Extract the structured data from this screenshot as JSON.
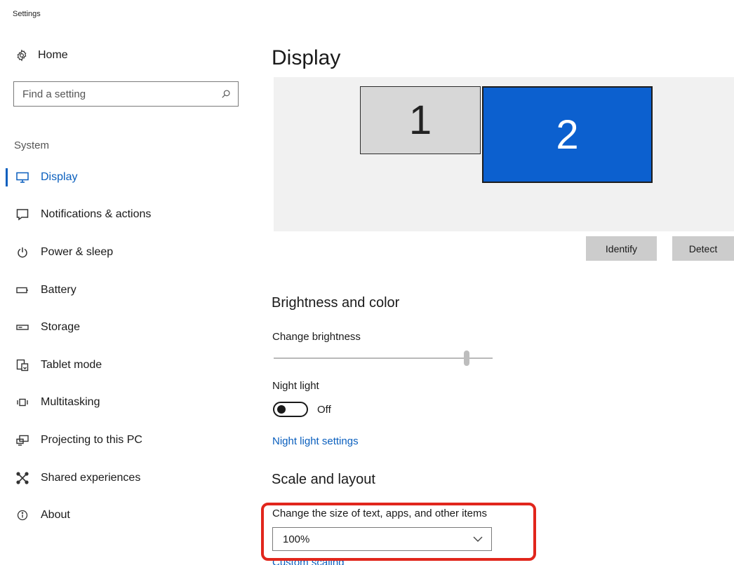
{
  "window": {
    "title": "Settings"
  },
  "sidebar": {
    "home_label": "Home",
    "search_placeholder": "Find a setting",
    "section_label": "System",
    "items": [
      {
        "label": "Display",
        "icon": "monitor-icon",
        "active": true
      },
      {
        "label": "Notifications & actions",
        "icon": "notification-icon",
        "active": false
      },
      {
        "label": "Power & sleep",
        "icon": "power-icon",
        "active": false
      },
      {
        "label": "Battery",
        "icon": "battery-icon",
        "active": false
      },
      {
        "label": "Storage",
        "icon": "storage-icon",
        "active": false
      },
      {
        "label": "Tablet mode",
        "icon": "tablet-mode-icon",
        "active": false
      },
      {
        "label": "Multitasking",
        "icon": "multitasking-icon",
        "active": false
      },
      {
        "label": "Projecting to this PC",
        "icon": "projecting-icon",
        "active": false
      },
      {
        "label": "Shared experiences",
        "icon": "shared-experiences-icon",
        "active": false
      },
      {
        "label": "About",
        "icon": "info-icon",
        "active": false
      }
    ]
  },
  "main": {
    "title": "Display",
    "monitors": [
      {
        "number": "1",
        "color": "#d7d7d7"
      },
      {
        "number": "2",
        "color": "#0c60cf"
      }
    ],
    "identify_label": "Identify",
    "detect_label": "Detect",
    "brightness_heading": "Brightness and color",
    "brightness_label": "Change brightness",
    "brightness_level": 0.89,
    "night_light_label": "Night light",
    "night_light_state": "Off",
    "night_light_link": "Night light settings",
    "scale_heading": "Scale and layout",
    "scale_label": "Change the size of text, apps, and other items",
    "scale_value": "100%",
    "partial_link": "Custom scaling"
  },
  "colors": {
    "accent": "#0a5fbe",
    "highlight": "#e1261c"
  }
}
